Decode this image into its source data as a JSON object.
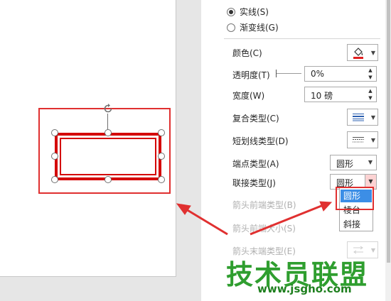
{
  "line_type": {
    "options": [
      {
        "label": "实线(S)",
        "selected": true
      },
      {
        "label": "渐变线(G)",
        "selected": false
      }
    ]
  },
  "properties": {
    "color_label": "颜色(C)",
    "color_swatch": "#e02020",
    "transparency_label": "透明度(T)",
    "transparency_value": "0%",
    "width_label": "宽度(W)",
    "width_value": "10 磅",
    "compound_label": "复合类型(C)",
    "dash_label": "短划线类型(D)",
    "cap_label": "端点类型(A)",
    "cap_value": "圆形",
    "join_label": "联接类型(J)",
    "join_value": "圆形",
    "arrow_begin_type_label": "箭头前端类型(B)",
    "arrow_begin_size_label": "箭头前端大小(S)",
    "arrow_end_type_label": "箭头末端类型(E)"
  },
  "join_dropdown": {
    "options": [
      "圆形",
      "棱台",
      "斜接"
    ],
    "highlighted_index": 0
  },
  "watermark": {
    "text": "技术员联盟",
    "url": "www.jsgho.com"
  },
  "colors": {
    "annotation_red": "#e03030",
    "shape_outline": "#d40000",
    "selection_blue": "#3c8ee6"
  }
}
